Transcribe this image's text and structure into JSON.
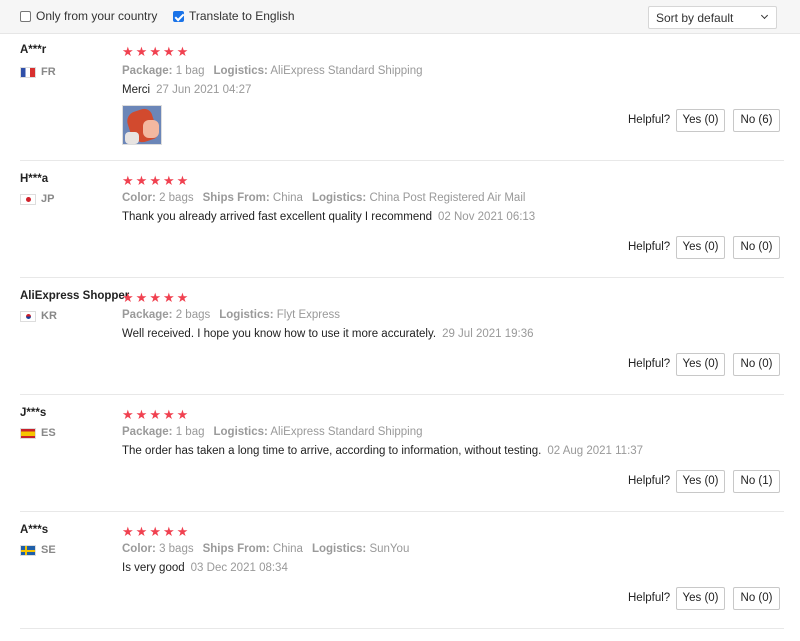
{
  "filters": {
    "only_country_label": "Only from your country",
    "only_country_checked": false,
    "translate_label": "Translate to English",
    "translate_checked": true,
    "sort_label": "Sort by default"
  },
  "helpful_label": "Helpful?",
  "reviews": [
    {
      "user": "A***r",
      "country_code": "FR",
      "flag": "flag-fr",
      "rating": 5,
      "details": [
        {
          "key": "Package:",
          "value": "1 bag"
        },
        {
          "key": "Logistics:",
          "value": "AliExpress Standard Shipping"
        }
      ],
      "text": "Merci",
      "date": "27 Jun 2021 04:27",
      "has_photo": true,
      "yes_label": "Yes (0)",
      "no_label": "No (6)"
    },
    {
      "user": "H***a",
      "country_code": "JP",
      "flag": "flag-jp",
      "rating": 5,
      "details": [
        {
          "key": "Color:",
          "value": "2 bags"
        },
        {
          "key": "Ships From:",
          "value": "China"
        },
        {
          "key": "Logistics:",
          "value": "China Post Registered Air Mail"
        }
      ],
      "text": "Thank you already arrived fast excellent quality I recommend",
      "date": "02 Nov 2021 06:13",
      "has_photo": false,
      "yes_label": "Yes (0)",
      "no_label": "No (0)"
    },
    {
      "user": "AliExpress Shopper",
      "country_code": "KR",
      "flag": "flag-kr",
      "rating": 5,
      "details": [
        {
          "key": "Package:",
          "value": "2 bags"
        },
        {
          "key": "Logistics:",
          "value": "Flyt Express"
        }
      ],
      "text": "Well received. I hope you know how to use it more accurately.",
      "date": "29 Jul 2021 19:36",
      "has_photo": false,
      "yes_label": "Yes (0)",
      "no_label": "No (0)"
    },
    {
      "user": "J***s",
      "country_code": "ES",
      "flag": "flag-es",
      "rating": 5,
      "details": [
        {
          "key": "Package:",
          "value": "1 bag"
        },
        {
          "key": "Logistics:",
          "value": "AliExpress Standard Shipping"
        }
      ],
      "text": "The order has taken a long time to arrive, according to information, without testing.",
      "date": "02 Aug 2021 11:37",
      "has_photo": false,
      "yes_label": "Yes (0)",
      "no_label": "No (1)"
    },
    {
      "user": "A***s",
      "country_code": "SE",
      "flag": "flag-se",
      "rating": 5,
      "details": [
        {
          "key": "Color:",
          "value": "3 bags"
        },
        {
          "key": "Ships From:",
          "value": "China"
        },
        {
          "key": "Logistics:",
          "value": "SunYou"
        }
      ],
      "text": "Is very good",
      "date": "03 Dec 2021 08:34",
      "has_photo": false,
      "yes_label": "Yes (0)",
      "no_label": "No (0)"
    }
  ]
}
